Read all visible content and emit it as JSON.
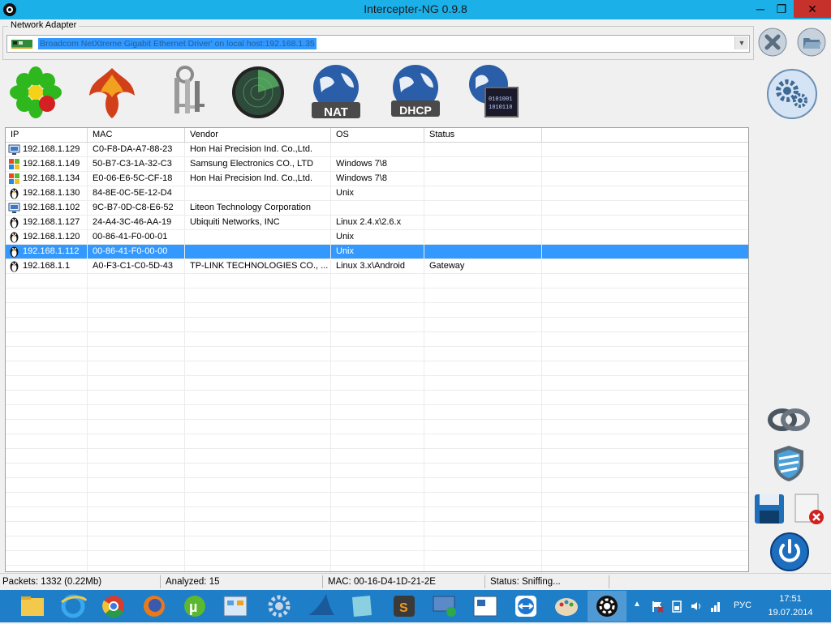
{
  "window": {
    "title": "Intercepter-NG 0.9.8",
    "minimize": "─",
    "maximize": "❐",
    "close": "✕"
  },
  "adapter": {
    "legend": "Network Adapter",
    "selected": "Broadcom NetXtreme Gigabit Ethernet Driver' on local host:192.168.1.35"
  },
  "toolbar": {
    "nat_label": "NAT",
    "dhcp_label": "DHCP"
  },
  "table": {
    "columns": [
      "IP",
      "MAC",
      "Vendor",
      "OS",
      "Status"
    ],
    "rows": [
      {
        "icon": "computer",
        "ip": "192.168.1.129",
        "mac": "C0-F8-DA-A7-88-23",
        "vendor": "Hon Hai Precision Ind. Co.,Ltd.",
        "os": "",
        "status": "",
        "selected": false
      },
      {
        "icon": "windows",
        "ip": "192.168.1.149",
        "mac": "50-B7-C3-1A-32-C3",
        "vendor": "Samsung Electronics CO., LTD",
        "os": "Windows 7\\8",
        "status": "",
        "selected": false
      },
      {
        "icon": "windows",
        "ip": "192.168.1.134",
        "mac": "E0-06-E6-5C-CF-18",
        "vendor": "Hon Hai Precision Ind. Co.,Ltd.",
        "os": "Windows 7\\8",
        "status": "",
        "selected": false
      },
      {
        "icon": "linux",
        "ip": "192.168.1.130",
        "mac": "84-8E-0C-5E-12-D4",
        "vendor": "",
        "os": "Unix",
        "status": "",
        "selected": false
      },
      {
        "icon": "computer",
        "ip": "192.168.1.102",
        "mac": "9C-B7-0D-C8-E6-52",
        "vendor": "Liteon Technology Corporation",
        "os": "",
        "status": "",
        "selected": false
      },
      {
        "icon": "linux",
        "ip": "192.168.1.127",
        "mac": "24-A4-3C-46-AA-19",
        "vendor": "Ubiquiti Networks, INC",
        "os": "Linux 2.4.x\\2.6.x",
        "status": "",
        "selected": false
      },
      {
        "icon": "linux",
        "ip": "192.168.1.120",
        "mac": "00-86-41-F0-00-01",
        "vendor": "",
        "os": "Unix",
        "status": "",
        "selected": false
      },
      {
        "icon": "linux",
        "ip": "192.168.1.112",
        "mac": "00-86-41-F0-00-00",
        "vendor": "",
        "os": "Unix",
        "status": "",
        "selected": true
      },
      {
        "icon": "linux",
        "ip": "192.168.1.1",
        "mac": "A0-F3-C1-C0-5D-43",
        "vendor": "TP-LINK TECHNOLOGIES CO., ...",
        "os": "Linux 3.x\\Android",
        "status": "Gateway",
        "selected": false
      }
    ]
  },
  "statusbar": {
    "packets": "Packets: 1332 (0.22Mb)",
    "analyzed": "Analyzed: 15",
    "mac": "MAC: 00-16-D4-1D-21-2E",
    "status": "Status: Sniffing..."
  },
  "taskbar": {
    "lang": "РУС",
    "time": "17:51",
    "date": "19.07.2014"
  },
  "colors": {
    "titlebar": "#1cb0e8",
    "close_button": "#c7312b",
    "selection": "#3399ff",
    "taskbar": "#1e7ec8"
  }
}
